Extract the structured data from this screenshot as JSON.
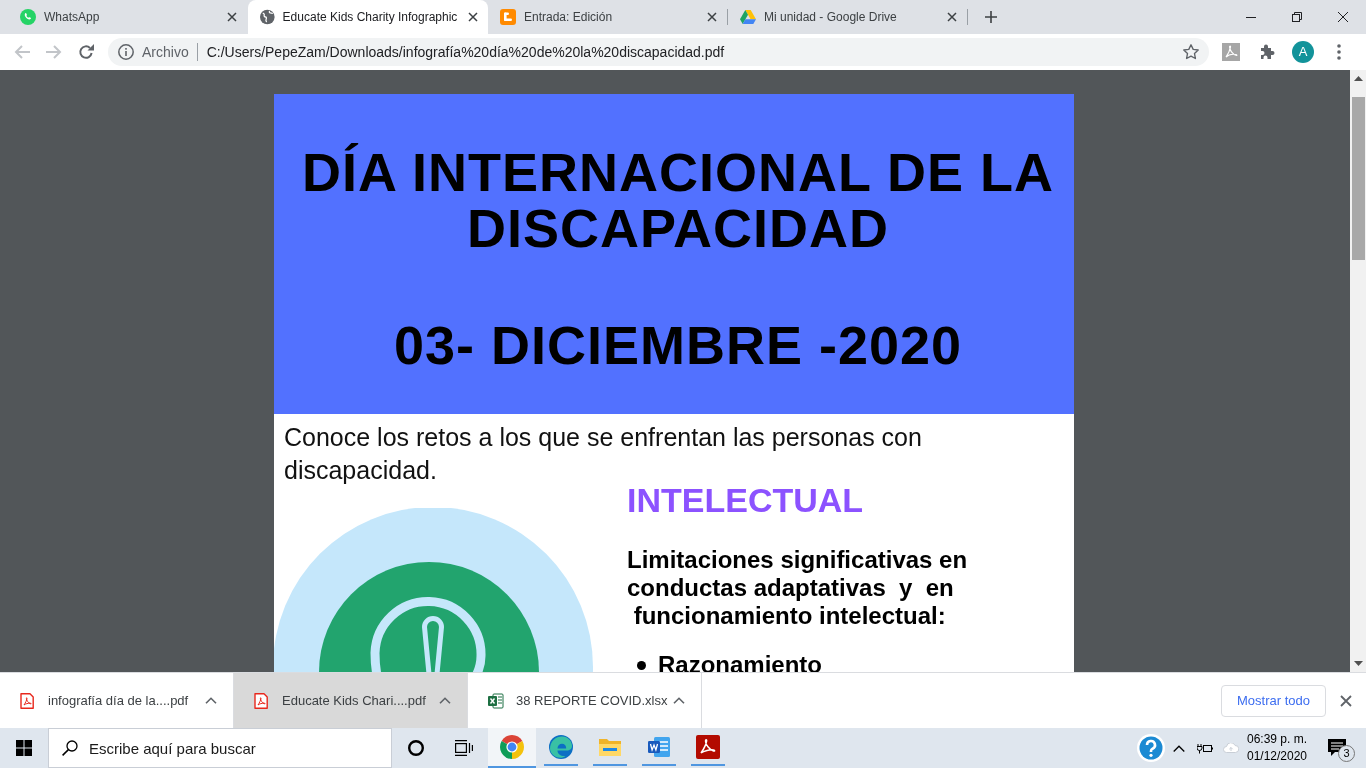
{
  "browser": {
    "tabs": [
      {
        "title": "WhatsApp",
        "kind": "whatsapp",
        "selected": false
      },
      {
        "title": "Educate Kids Charity Infographic",
        "kind": "globe",
        "selected": true
      },
      {
        "title": "Entrada: Edición",
        "kind": "blogger",
        "selected": false
      },
      {
        "title": "Mi unidad - Google Drive",
        "kind": "drive",
        "selected": false
      }
    ],
    "navigation": {
      "back": {
        "disabled": true
      },
      "forward": {
        "disabled": true
      }
    },
    "address_bar": {
      "security_label": "Archivo",
      "url": "C:/Users/PepeZam/Downloads/infografía%20día%20de%20la%20discapacidad.pdf"
    },
    "profile_initial": "A"
  },
  "document": {
    "title_lines": [
      "DÍA INTERNACIONAL DE LA",
      "DISCAPACIDAD"
    ],
    "date": "03- DICIEMBRE -2020",
    "intro": "Conoce los retos a los que se enfrentan las personas con discapacidad.",
    "section": {
      "heading": "INTELECTUAL",
      "description_lines": [
        "Limitaciones significativas en",
        "conductas adaptativas  y  en",
        " funcionamiento intelectual:"
      ],
      "bullets": [
        "Razonamiento"
      ]
    }
  },
  "downloads": {
    "items": [
      {
        "name": "infografía día de la....pdf",
        "kind": "pdf",
        "highlighted": false
      },
      {
        "name": "Educate Kids Chari....pdf",
        "kind": "pdf",
        "highlighted": true
      },
      {
        "name": "38 REPORTE COVID.xlsx",
        "kind": "xlsx",
        "highlighted": false
      }
    ],
    "show_all": "Mostrar todo"
  },
  "taskbar": {
    "search_placeholder": "Escribe aquí para buscar",
    "apps": [
      {
        "kind": "chrome",
        "active": true
      },
      {
        "kind": "edge",
        "active": false
      },
      {
        "kind": "explorer",
        "active": false
      },
      {
        "kind": "word",
        "active": false
      },
      {
        "kind": "acrobat",
        "active": false
      }
    ],
    "clock": {
      "time": "06:39 p. m.",
      "date": "01/12/2020"
    },
    "notification_count": "3"
  }
}
